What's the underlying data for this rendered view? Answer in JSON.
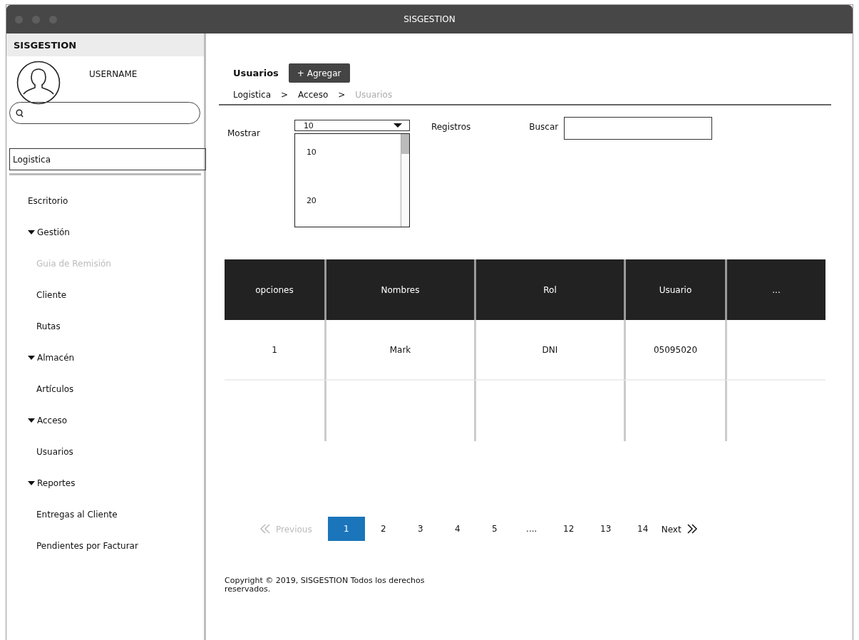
{
  "window": {
    "title": "SISGESTION"
  },
  "sidebar": {
    "brand": "SISGESTION",
    "username": "USERNAME",
    "module": "Logistica",
    "items": [
      {
        "label": "Escritorio",
        "kind": "link",
        "disabled": false
      },
      {
        "label": "Gestión",
        "kind": "group",
        "expanded": true,
        "children": [
          {
            "label": "Guia de Remisión",
            "kind": "link",
            "disabled": true
          },
          {
            "label": "Cliente",
            "kind": "link",
            "disabled": false
          },
          {
            "label": "Rutas",
            "kind": "link",
            "disabled": false
          }
        ]
      },
      {
        "label": "Almacén",
        "kind": "group",
        "expanded": true,
        "children": [
          {
            "label": "Artículos",
            "kind": "link",
            "disabled": false
          }
        ]
      },
      {
        "label": "Acceso",
        "kind": "group",
        "expanded": true,
        "children": [
          {
            "label": "Usuarios",
            "kind": "link",
            "disabled": false
          }
        ]
      },
      {
        "label": "Reportes",
        "kind": "group",
        "expanded": true,
        "children": [
          {
            "label": "Entregas al Cliente",
            "kind": "link",
            "disabled": false
          },
          {
            "label": "Pendientes por Facturar",
            "kind": "link",
            "disabled": false
          }
        ]
      }
    ]
  },
  "header": {
    "title": "Usuarios",
    "add_button": "+ Agregar",
    "breadcrumb": [
      {
        "label": "Logistica",
        "current": false
      },
      {
        "label": "Acceso",
        "current": false
      },
      {
        "label": "Usuarios",
        "current": true
      }
    ],
    "separator": ">"
  },
  "controls": {
    "show_label": "Mostrar",
    "page_size": {
      "value": "10",
      "expanded": true,
      "options": [
        "10",
        "20"
      ]
    },
    "records_label": "Registros",
    "search_label": "Buscar"
  },
  "table": {
    "columns": [
      "opciones",
      "Nombres",
      "Rol",
      "Usuario",
      "..."
    ],
    "rows": [
      [
        "1",
        "Mark",
        "DNI",
        "05095020",
        ""
      ],
      [
        "",
        "",
        "",
        "",
        ""
      ]
    ]
  },
  "pagination": {
    "previous": {
      "label": "Previous",
      "disabled": true
    },
    "next": {
      "label": "Next",
      "disabled": false
    },
    "pages": [
      {
        "label": "1",
        "selected": true
      },
      {
        "label": "2",
        "selected": false
      },
      {
        "label": "3",
        "selected": false
      },
      {
        "label": "4",
        "selected": false
      },
      {
        "label": "5",
        "selected": false
      },
      {
        "label": "....",
        "selected": false
      },
      {
        "label": "12",
        "selected": false
      },
      {
        "label": "13",
        "selected": false
      },
      {
        "label": "14",
        "selected": false
      }
    ]
  },
  "footer": "Copyright © 2019, SISGESTION  Todos los derechos reservados."
}
